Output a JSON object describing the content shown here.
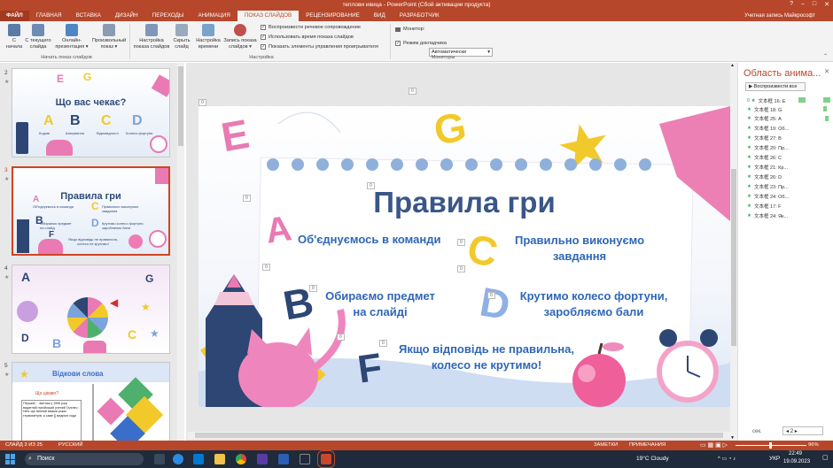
{
  "window": {
    "title": "теплови ивица - PowerPoint (Сбой активации продукта)",
    "controls": [
      "?",
      "–",
      "□",
      "✕"
    ]
  },
  "tabs": [
    "ФАЙЛ",
    "ГЛАВНАЯ",
    "ВСТАВКА",
    "ДИЗАЙН",
    "ПЕРЕХОДЫ",
    "АНИМАЦИЯ",
    "ПОКАЗ СЛАЙДОВ",
    "РЕЦЕНЗИРОВАНИЕ",
    "ВИД",
    "РАЗРАБОТЧИК"
  ],
  "active_tab": "ПОКАЗ СЛАЙДОВ",
  "account": "Учетная запись Майкрософт",
  "ribbon": {
    "buttons": [
      {
        "label": "С\nначала",
        "icon": "play-start-icon"
      },
      {
        "label": "С текущего\nслайда",
        "icon": "play-current-icon"
      },
      {
        "label": "Онлайн-\nпрезентация ▾",
        "icon": "online-present-icon"
      },
      {
        "label": "Произвольный\nпоказ ▾",
        "icon": "custom-show-icon"
      },
      {
        "label": "Настройка\nпоказа слайдов",
        "icon": "setup-show-icon"
      },
      {
        "label": "Скрыть\nслайд",
        "icon": "hide-slide-icon"
      },
      {
        "label": "Настройка\nвремени",
        "icon": "rehearse-icon"
      },
      {
        "label": "Запись показа\nслайдов ▾",
        "icon": "record-icon"
      }
    ],
    "group_start": "Начать показ слайдов",
    "group_setup": "Настройка",
    "group_monitors": "Мониторы",
    "checks": [
      "Воспроизвести речевое сопровождение",
      "Использовать время показа слайдов",
      "Показать элементы управления проигрывателя"
    ],
    "monitor_label": "Монитор:",
    "monitor_value": "Автоматически",
    "presenter_view": "Режим докладчика"
  },
  "slides": [
    {
      "num": "2",
      "title": "Що вас чекає?"
    },
    {
      "num": "3",
      "title": "Правила гри"
    },
    {
      "num": "4",
      "title": ""
    },
    {
      "num": "5",
      "title": "Відкови слова"
    }
  ],
  "slide2": {
    "labels": [
      "Кодові",
      "Шанування",
      "Відповідності",
      "Колесо фортуни"
    ]
  },
  "slide3_thumb": {
    "items": [
      "Об'єднуємось в команди",
      "Правильно виконуємо завдання",
      "Обираємо предмет на слайд",
      "Крутимо колесо фортуни, заробляємо бали",
      "Якщо відповідь не правильна, колесо не крутимо!"
    ]
  },
  "slide5": {
    "sub": "Що цікаво?",
    "text": "Перший ... винтаж у 1596 році видатний італійський учений Галілео. Ніне-сірі винний віками роках термометрів, а саме [] медичні ходи"
  },
  "main_slide": {
    "title": "Правила гри",
    "items": [
      "Об'єднуємось в команди",
      "Правильно виконуємо завдання",
      "Обираємо предмет на слайді",
      "Крутимо колесо фортуни, заробляємо бали",
      "Якщо відповідь не правильна, колесо не крутимо!"
    ],
    "letters": [
      "E",
      "G",
      "A",
      "C",
      "B",
      "D",
      "F"
    ],
    "placeholders": [
      "0",
      "0",
      "0",
      "0",
      "0",
      "0",
      "0",
      "0",
      "0",
      "0",
      "0",
      "0",
      "0"
    ]
  },
  "anim_pane": {
    "title": "Область анима...",
    "play_all": "Воспроизвести все",
    "items": [
      "文本框 16: E",
      "文本框 18: G",
      "文本框 25: A",
      "文本框 19: Об...",
      "文本框 27: B",
      "文本框 20: Пр...",
      "文本框 26: C",
      "文本框 21: Кр...",
      "文本框 26: D",
      "文本框 23: Пр...",
      "文本框 24: Об...",
      "文本框 17: F",
      "文本框 24: Як..."
    ]
  },
  "nav": {
    "label": "сек.",
    "value": "2"
  },
  "status": {
    "slide": "СЛАЙД 3 ИЗ 25",
    "lang": "РУССКИЙ",
    "notes": "ЗАМЕТКИ",
    "comments": "ПРИМЕЧАНИЯ",
    "zoom": "96%"
  },
  "taskbar": {
    "search": "Поиск",
    "weather": "19°C  Cloudy",
    "lang": "УКР",
    "time": "22:49",
    "date": "19.09.2023"
  },
  "colors": {
    "accent": "#b7472a",
    "title_blue": "#2f4a7c",
    "pink": "#e97ab3",
    "yellow": "#f2c92b",
    "navy": "#2d4673"
  }
}
